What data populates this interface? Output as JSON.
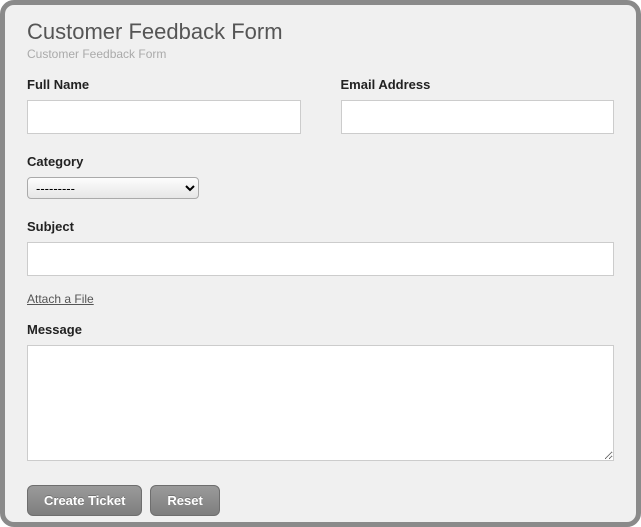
{
  "form": {
    "title": "Customer Feedback Form",
    "subtitle": "Customer Feedback Form",
    "full_name_label": "Full Name",
    "full_name_value": "",
    "email_label": "Email Address",
    "email_value": "",
    "category_label": "Category",
    "category_selected": "---------",
    "subject_label": "Subject",
    "subject_value": "",
    "attach_link": "Attach a File",
    "message_label": "Message",
    "message_value": "",
    "submit_label": "Create Ticket",
    "reset_label": "Reset"
  }
}
